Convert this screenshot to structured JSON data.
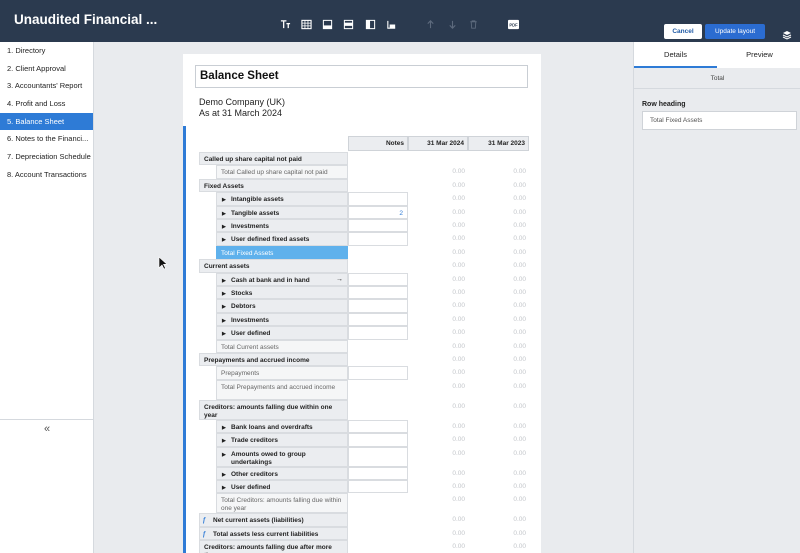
{
  "app": {
    "title": "Unaudited Financial ..."
  },
  "toolbar": {
    "tools": [
      "text-format-icon",
      "table-icon",
      "align-bottom-icon",
      "align-middle-icon",
      "column-layout-icon",
      "row-layout-icon",
      "move-up-icon",
      "move-down-icon",
      "delete-icon",
      "pdf-icon"
    ],
    "pdf_label": "PDF",
    "cancel_label": "Cancel",
    "update_label": "Update layout"
  },
  "sidebar": {
    "items": [
      {
        "label": "1. Directory"
      },
      {
        "label": "2. Client Approval"
      },
      {
        "label": "3. Accountants' Report"
      },
      {
        "label": "4. Profit and Loss"
      },
      {
        "label": "5. Balance Sheet",
        "active": true
      },
      {
        "label": "6. Notes to the Financi..."
      },
      {
        "label": "7. Depreciation Schedule"
      },
      {
        "label": "8. Account Transactions"
      }
    ],
    "collapse_glyph": "«"
  },
  "document": {
    "title": "Balance Sheet",
    "company": "Demo Company (UK)",
    "as_at": "As at 31 March 2024",
    "columns": {
      "notes": "Notes",
      "col1": "31 Mar 2024",
      "col2": "31 Mar 2023"
    },
    "rows": [
      {
        "label": "Called up share capital not paid",
        "kind": "heading",
        "v1": "",
        "v2": ""
      },
      {
        "label": "Total Called up share capital not paid",
        "kind": "total",
        "v1": "0.00",
        "v2": "0.00"
      },
      {
        "label": "Fixed Assets",
        "kind": "heading",
        "v1": "0.00",
        "v2": "0.00"
      },
      {
        "label": "Intangible assets",
        "kind": "sub",
        "notes": "",
        "v1": "0.00",
        "v2": "0.00"
      },
      {
        "label": "Tangible assets",
        "kind": "sub",
        "notes": "2",
        "v1": "0.00",
        "v2": "0.00"
      },
      {
        "label": "Investments",
        "kind": "sub",
        "notes": "",
        "v1": "0.00",
        "v2": "0.00"
      },
      {
        "label": "User defined fixed assets",
        "kind": "sub",
        "notes": "",
        "v1": "0.00",
        "v2": "0.00"
      },
      {
        "label": "Total Fixed Assets",
        "kind": "selected",
        "v1": "0.00",
        "v2": "0.00"
      },
      {
        "label": "Current assets",
        "kind": "heading",
        "v1": "0.00",
        "v2": "0.00"
      },
      {
        "label": "Cash at bank and in hand",
        "kind": "sub",
        "arrow": true,
        "notes": "",
        "v1": "0.00",
        "v2": "0.00"
      },
      {
        "label": "Stocks",
        "kind": "sub",
        "notes": "",
        "v1": "0.00",
        "v2": "0.00"
      },
      {
        "label": "Debtors",
        "kind": "sub",
        "notes": "",
        "v1": "0.00",
        "v2": "0.00"
      },
      {
        "label": "Investments",
        "kind": "sub",
        "notes": "",
        "v1": "0.00",
        "v2": "0.00"
      },
      {
        "label": "User defined",
        "kind": "sub",
        "notes": "",
        "v1": "0.00",
        "v2": "0.00"
      },
      {
        "label": "Total Current assets",
        "kind": "total",
        "v1": "0.00",
        "v2": "0.00"
      },
      {
        "label": "Prepayments and accrued income",
        "kind": "heading",
        "v1": "0.00",
        "v2": "0.00"
      },
      {
        "label": "Prepayments",
        "kind": "plain",
        "notes": "",
        "v1": "0.00",
        "v2": "0.00"
      },
      {
        "label": "Total Prepayments and accrued income",
        "kind": "total2",
        "v1": "0.00",
        "v2": "0.00"
      },
      {
        "label": "Creditors: amounts falling due within one year",
        "kind": "heading2",
        "v1": "0.00",
        "v2": "0.00"
      },
      {
        "label": "Bank loans and overdrafts",
        "kind": "sub",
        "notes": "",
        "v1": "0.00",
        "v2": "0.00"
      },
      {
        "label": "Trade creditors",
        "kind": "sub",
        "notes": "",
        "v1": "0.00",
        "v2": "0.00"
      },
      {
        "label": "Amounts owed to group undertakings",
        "kind": "sub2",
        "notes": "",
        "v1": "0.00",
        "v2": "0.00"
      },
      {
        "label": "Other creditors",
        "kind": "sub",
        "notes": "",
        "v1": "0.00",
        "v2": "0.00"
      },
      {
        "label": "User defined",
        "kind": "sub",
        "notes": "",
        "v1": "0.00",
        "v2": "0.00"
      },
      {
        "label": "Total Creditors: amounts falling due within one year",
        "kind": "total2",
        "v1": "0.00",
        "v2": "0.00"
      },
      {
        "label": "Net current assets (liabilities)",
        "kind": "formula",
        "v1": "0.00",
        "v2": "0.00"
      },
      {
        "label": "Total assets less current liabilities",
        "kind": "formula",
        "v1": "0.00",
        "v2": "0.00"
      },
      {
        "label": "Creditors: amounts falling due after more than one year",
        "kind": "heading2",
        "v1": "0.00",
        "v2": "0.00"
      }
    ]
  },
  "panel": {
    "tabs": [
      {
        "label": "Details",
        "active": true
      },
      {
        "label": "Preview"
      }
    ],
    "section": "Total",
    "row_heading_label": "Row heading",
    "row_heading_value": "Total Fixed Assets"
  }
}
